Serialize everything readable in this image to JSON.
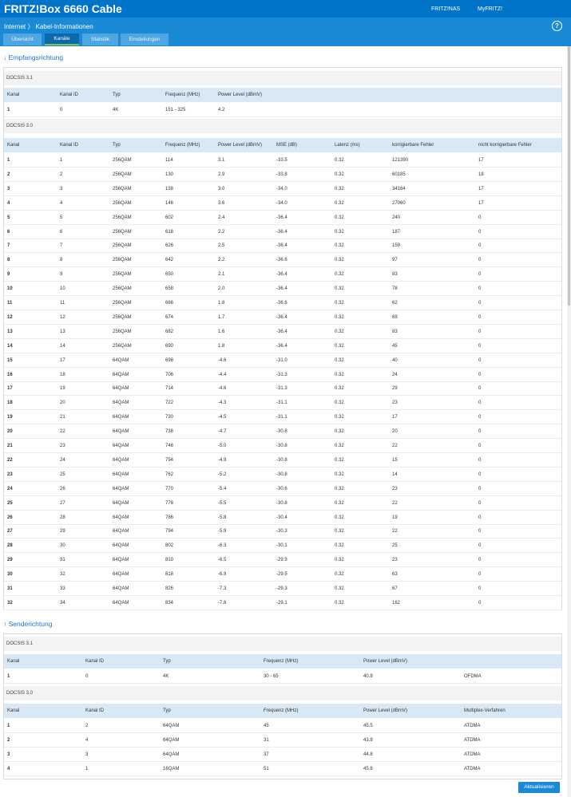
{
  "header": {
    "brand": "FRITZ!Box 6660 Cable",
    "nav": [
      "FRITZ!NAS",
      "MyFRITZ!"
    ]
  },
  "breadcrumb": {
    "parent": "Internet",
    "sep": "〉",
    "current": "Kabel-Informationen"
  },
  "tabs": [
    {
      "label": "Übersicht"
    },
    {
      "label": "Kanäle",
      "active": true
    },
    {
      "label": "Statistik"
    },
    {
      "label": "Einstellungen"
    }
  ],
  "empfang": {
    "title": "Empfangsrichtung",
    "docsis31": {
      "label": "DOCSIS 3.1",
      "columns": [
        "Kanal",
        "Kanal ID",
        "Typ",
        "Frequenz (MHz)",
        "Power Level (dBmV)"
      ],
      "rows": [
        [
          "1",
          "0",
          "4K",
          "151 - 325",
          "4.2"
        ]
      ]
    },
    "docsis30": {
      "label": "DOCSIS 3.0",
      "columns": [
        "Kanal",
        "Kanal ID",
        "Typ",
        "Frequenz (MHz)",
        "Power Level (dBmV)",
        "MSE (dB)",
        "Latenz (ms)",
        "korrigierbare Fehler",
        "nicht korrigierbare Fehler"
      ],
      "rows": [
        [
          "1",
          "1",
          "256QAM",
          "114",
          "3.1",
          "-33.5",
          "0.32",
          "121390",
          "17"
        ],
        [
          "2",
          "2",
          "256QAM",
          "130",
          "2.9",
          "-33.8",
          "0.32",
          "60185",
          "18"
        ],
        [
          "3",
          "3",
          "256QAM",
          "138",
          "3.0",
          "-34.0",
          "0.32",
          "34164",
          "17"
        ],
        [
          "4",
          "4",
          "256QAM",
          "146",
          "3.6",
          "-34.0",
          "0.32",
          "27060",
          "17"
        ],
        [
          "5",
          "5",
          "256QAM",
          "602",
          "2.4",
          "-36.4",
          "0.32",
          "240",
          "0"
        ],
        [
          "6",
          "6",
          "256QAM",
          "618",
          "2.2",
          "-36.4",
          "0.32",
          "187",
          "0"
        ],
        [
          "7",
          "7",
          "256QAM",
          "626",
          "2.5",
          "-36.4",
          "0.32",
          "159",
          "0"
        ],
        [
          "8",
          "8",
          "256QAM",
          "642",
          "2.2",
          "-36.6",
          "0.32",
          "97",
          "0"
        ],
        [
          "9",
          "9",
          "256QAM",
          "650",
          "2.1",
          "-36.4",
          "0.32",
          "83",
          "0"
        ],
        [
          "10",
          "10",
          "256QAM",
          "658",
          "2.0",
          "-36.4",
          "0.32",
          "78",
          "0"
        ],
        [
          "11",
          "11",
          "256QAM",
          "666",
          "1.8",
          "-36.6",
          "0.32",
          "62",
          "0"
        ],
        [
          "12",
          "12",
          "256QAM",
          "674",
          "1.7",
          "-36.4",
          "0.32",
          "69",
          "0"
        ],
        [
          "13",
          "13",
          "256QAM",
          "682",
          "1.6",
          "-36.4",
          "0.32",
          "83",
          "0"
        ],
        [
          "14",
          "14",
          "256QAM",
          "690",
          "1.8",
          "-36.4",
          "0.32",
          "45",
          "0"
        ],
        [
          "15",
          "17",
          "64QAM",
          "698",
          "-4.6",
          "-31.0",
          "0.32",
          "40",
          "0"
        ],
        [
          "16",
          "18",
          "64QAM",
          "706",
          "-4.4",
          "-31.3",
          "0.32",
          "24",
          "0"
        ],
        [
          "17",
          "19",
          "64QAM",
          "714",
          "-4.6",
          "-31.3",
          "0.32",
          "29",
          "0"
        ],
        [
          "18",
          "20",
          "64QAM",
          "722",
          "-4.3",
          "-31.1",
          "0.32",
          "23",
          "0"
        ],
        [
          "19",
          "21",
          "64QAM",
          "730",
          "-4.5",
          "-31.1",
          "0.32",
          "17",
          "0"
        ],
        [
          "20",
          "22",
          "64QAM",
          "738",
          "-4.7",
          "-30.8",
          "0.32",
          "20",
          "0"
        ],
        [
          "21",
          "23",
          "64QAM",
          "746",
          "-5.0",
          "-30.8",
          "0.32",
          "22",
          "0"
        ],
        [
          "22",
          "24",
          "64QAM",
          "754",
          "-4.9",
          "-30.8",
          "0.32",
          "15",
          "0"
        ],
        [
          "23",
          "25",
          "64QAM",
          "762",
          "-5.2",
          "-30.8",
          "0.32",
          "14",
          "0"
        ],
        [
          "24",
          "26",
          "64QAM",
          "770",
          "-5.4",
          "-30.6",
          "0.32",
          "23",
          "0"
        ],
        [
          "25",
          "27",
          "64QAM",
          "778",
          "-5.5",
          "-30.8",
          "0.32",
          "22",
          "0"
        ],
        [
          "26",
          "28",
          "64QAM",
          "786",
          "-5.8",
          "-30.4",
          "0.32",
          "19",
          "0"
        ],
        [
          "27",
          "29",
          "64QAM",
          "794",
          "-5.9",
          "-30.3",
          "0.32",
          "22",
          "0"
        ],
        [
          "28",
          "30",
          "64QAM",
          "802",
          "-6.3",
          "-30.1",
          "0.32",
          "25",
          "0"
        ],
        [
          "29",
          "31",
          "64QAM",
          "810",
          "-6.5",
          "-29.9",
          "0.32",
          "23",
          "0"
        ],
        [
          "30",
          "32",
          "64QAM",
          "818",
          "-6.9",
          "-29.5",
          "0.32",
          "63",
          "0"
        ],
        [
          "31",
          "33",
          "64QAM",
          "826",
          "-7.3",
          "-29.3",
          "0.32",
          "67",
          "0"
        ],
        [
          "32",
          "34",
          "64QAM",
          "834",
          "-7.6",
          "-29.1",
          "0.32",
          "162",
          "0"
        ]
      ]
    }
  },
  "sende": {
    "title": "Senderichtung",
    "docsis31": {
      "label": "DOCSIS 3.1",
      "columns": [
        "Kanal",
        "Kanal ID",
        "Typ",
        "Frequenz (MHz)",
        "Power Level (dBmV)",
        ""
      ],
      "rows": [
        [
          "1",
          "0",
          "4K",
          "30 - 65",
          "40.8",
          "OFDMA"
        ]
      ]
    },
    "docsis30": {
      "label": "DOCSIS 3.0",
      "columns": [
        "Kanal",
        "Kanal ID",
        "Typ",
        "Frequenz (MHz)",
        "Power Level (dBmV)",
        "Multiplex-Verfahren"
      ],
      "rows": [
        [
          "1",
          "2",
          "64QAM",
          "45",
          "45.5",
          "ATDMA"
        ],
        [
          "2",
          "4",
          "64QAM",
          "31",
          "43.8",
          "ATDMA"
        ],
        [
          "3",
          "3",
          "64QAM",
          "37",
          "44.8",
          "ATDMA"
        ],
        [
          "4",
          "1",
          "16QAM",
          "51",
          "45.8",
          "ATDMA"
        ]
      ]
    }
  },
  "refresh_label": "Aktualisieren",
  "colors": {
    "topbar": "#0074c9",
    "subbar": "#1a8ad6",
    "tab_active": "#0d67ad",
    "header_row": "#d9e8f5",
    "link": "#1976d2"
  }
}
